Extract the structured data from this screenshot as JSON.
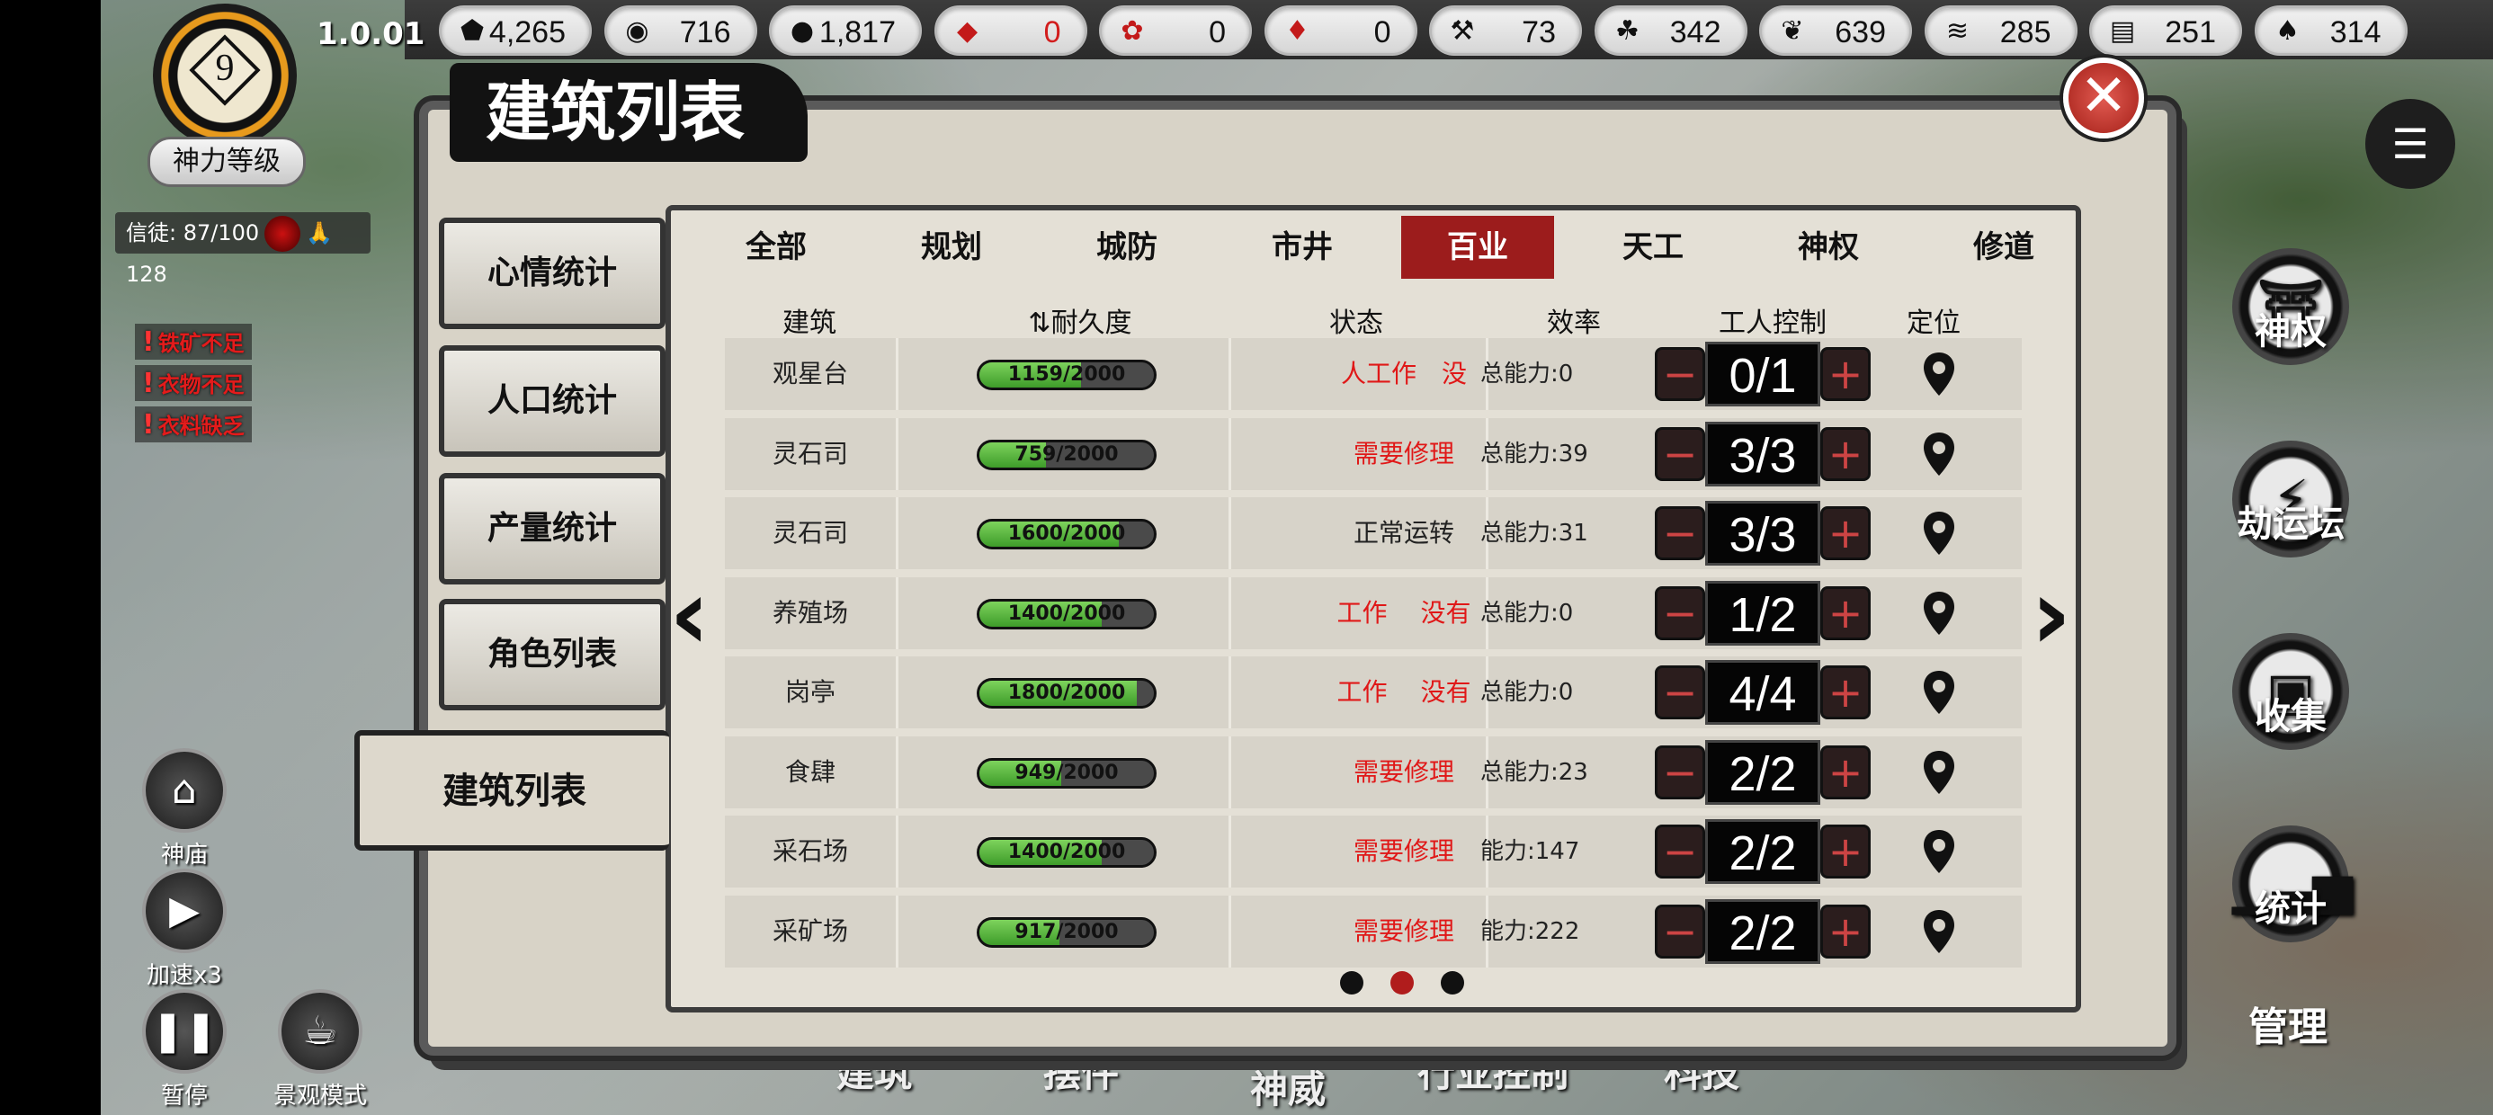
{
  "version": "1.0.01",
  "level": {
    "value": "9",
    "button_label": "神力等级"
  },
  "faith": {
    "text": "信徒: 87/100",
    "count": "128"
  },
  "warnings": [
    "铁矿不足",
    "衣物不足",
    "衣料缺乏"
  ],
  "resources": [
    {
      "icon": "stone-icon",
      "value": "4,265"
    },
    {
      "icon": "ore-icon",
      "value": "716"
    },
    {
      "icon": "rock-icon",
      "value": "1,817"
    },
    {
      "icon": "gem-icon",
      "value": "0"
    },
    {
      "icon": "flower-icon",
      "value": "0"
    },
    {
      "icon": "cloth-icon",
      "value": "0"
    },
    {
      "icon": "tool-icon",
      "value": "73"
    },
    {
      "icon": "herb-icon",
      "value": "342"
    },
    {
      "icon": "leaf-icon",
      "value": "639"
    },
    {
      "icon": "grass-icon",
      "value": "285"
    },
    {
      "icon": "building-icon",
      "value": "251"
    },
    {
      "icon": "bottle-icon",
      "value": "314"
    }
  ],
  "panel": {
    "title": "建筑列表",
    "side_tabs": [
      "心情统计",
      "人口统计",
      "产量统计",
      "角色列表",
      "建筑列表"
    ],
    "category_tabs": [
      "全部",
      "规划",
      "城防",
      "市井",
      "百业",
      "天工",
      "神权",
      "修道"
    ],
    "active_category": "百业",
    "columns": [
      "建筑",
      "耐久度",
      "状态",
      "效率",
      "工人控制",
      "定位"
    ],
    "rows": [
      {
        "name": "观星台",
        "durability": "1159/2000",
        "fill": 0.58,
        "status": "人工作　没",
        "status_color": "red",
        "efficiency": "总能力:0",
        "workers": "0/1"
      },
      {
        "name": "灵石司",
        "durability": "759/2000",
        "fill": 0.38,
        "status": "需要修理",
        "status_color": "red",
        "efficiency": "总能力:39",
        "workers": "3/3"
      },
      {
        "name": "灵石司",
        "durability": "1600/2000",
        "fill": 0.8,
        "status": "正常运转",
        "status_color": "dark",
        "efficiency": "总能力:31",
        "workers": "3/3"
      },
      {
        "name": "养殖场",
        "durability": "1400/2000",
        "fill": 0.7,
        "status": "工作　 没有",
        "status_color": "red",
        "efficiency": "总能力:0",
        "workers": "1/2"
      },
      {
        "name": "岗亭",
        "durability": "1800/2000",
        "fill": 0.9,
        "status": "工作　 没有",
        "status_color": "red",
        "efficiency": "总能力:0",
        "workers": "4/4"
      },
      {
        "name": "食肆",
        "durability": "949/2000",
        "fill": 0.47,
        "status": "需要修理",
        "status_color": "red",
        "efficiency": "总能力:23",
        "workers": "2/2"
      },
      {
        "name": "采石场",
        "durability": "1400/2000",
        "fill": 0.7,
        "status": "需要修理",
        "status_color": "red",
        "efficiency": "能力:147",
        "workers": "2/2"
      },
      {
        "name": "采矿场",
        "durability": "917/2000",
        "fill": 0.46,
        "status": "需要修理",
        "status_color": "red",
        "efficiency": "能力:222",
        "workers": "2/2"
      }
    ],
    "pages": {
      "total": 3,
      "current": 2
    }
  },
  "left_buttons": [
    {
      "label": "神庙",
      "icon": "house-icon"
    },
    {
      "label": "加速x3",
      "icon": "fast-forward-icon"
    },
    {
      "label": "暂停",
      "icon": "pause-icon"
    },
    {
      "label": "景观模式",
      "icon": "landscape-icon"
    }
  ],
  "right_buttons": [
    {
      "label": "神权",
      "icon": "temple-icon"
    },
    {
      "label": "劫运坛",
      "icon": "altar-icon"
    },
    {
      "label": "收集",
      "icon": "collect-icon"
    },
    {
      "label": "统计",
      "icon": "chart-icon"
    }
  ],
  "manage_label": "管理",
  "bottom_nav": [
    "建筑",
    "摆件",
    "神威",
    "行业控制",
    "科技"
  ]
}
